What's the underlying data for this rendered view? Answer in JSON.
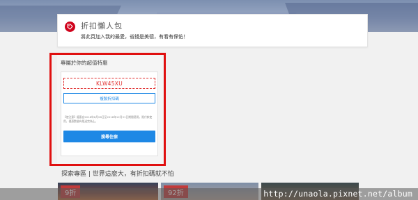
{
  "collection": {
    "title": "折扣懶人包",
    "subtitle": "將此頁加入我的最愛，省錢是美德，有看有保佑！"
  },
  "exclusive": {
    "heading": "專屬於你的超值特惠",
    "coupon_code": "KLW45XU",
    "copy_button_label": "複製折扣碼",
    "notice": "【使注意】優惠自2018年8月28日至2018年12月31日期間適用，限付款使用，優惠數量有限送完為止。",
    "search_button_label": "搜尋住宿"
  },
  "explore": {
    "heading": "探索專區 | 世界這麼大，有折扣碼就不怕"
  },
  "deals": [
    {
      "badge": "9折"
    },
    {
      "badge": "92折"
    }
  ],
  "watermark": {
    "text": "http://unaola.pixnet.net/album"
  },
  "colors": {
    "accent_red": "#e02a2a",
    "highlight_red": "#e01010",
    "primary_blue": "#1e88e5",
    "badge_red": "#c23b3b"
  },
  "icons": {
    "collection": "tag-icon"
  }
}
